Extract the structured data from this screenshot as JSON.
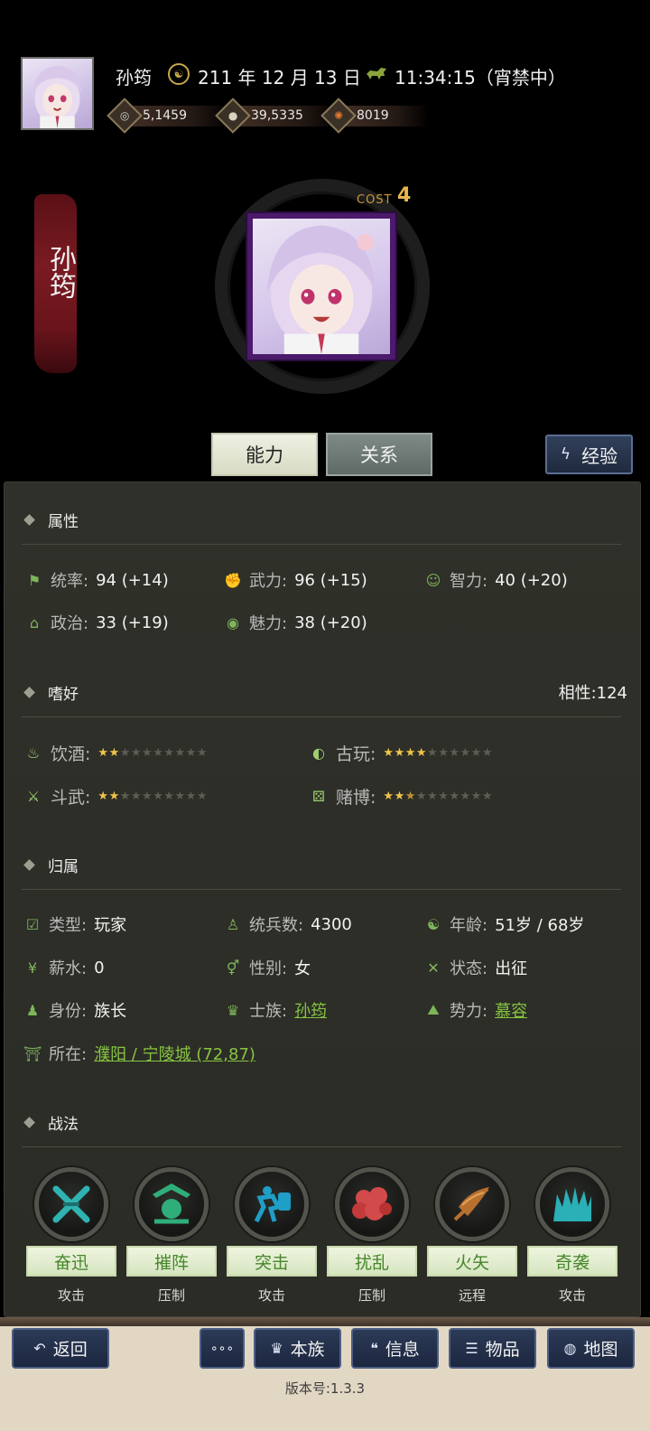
{
  "header": {
    "name": "孙筠",
    "date": "211 年 12 月 13 日",
    "time": "11:34:15（宵禁中）",
    "date_icon": "calendar-clock-icon",
    "time_icon": "horse-icon",
    "resources": [
      {
        "icon": "coin-icon",
        "value": "5,1459"
      },
      {
        "icon": "grain-icon",
        "value": "39,5335"
      },
      {
        "icon": "token-icon",
        "value": "8019"
      }
    ]
  },
  "character": {
    "banner_name": "孙筠",
    "cost_label": "COST",
    "cost_value": "4"
  },
  "tabs": {
    "ability": "能力",
    "relation": "关系",
    "experience": "经验"
  },
  "attributes": {
    "title": "属性",
    "items": [
      {
        "label": "统率:",
        "value": "94 (+14)"
      },
      {
        "label": "武力:",
        "value": "96 (+15)"
      },
      {
        "label": "智力:",
        "value": "40 (+20)"
      },
      {
        "label": "政治:",
        "value": "33 (+19)"
      },
      {
        "label": "魅力:",
        "value": "38 (+20)"
      }
    ]
  },
  "hobbies": {
    "title": "嗜好",
    "affinity": "相性:124",
    "items": [
      {
        "label": "饮酒:",
        "stars": 2,
        "max": 10
      },
      {
        "label": "古玩:",
        "stars": 4,
        "max": 10
      },
      {
        "label": "斗武:",
        "stars": 2,
        "max": 10
      },
      {
        "label": "赌博:",
        "stars": 2.5,
        "max": 10
      }
    ]
  },
  "belonging": {
    "title": "归属",
    "items": [
      {
        "label": "类型:",
        "value": "玩家"
      },
      {
        "label": "统兵数:",
        "value": "4300"
      },
      {
        "label": "年龄:",
        "value": "51岁 / 68岁"
      },
      {
        "label": "薪水:",
        "value": "0"
      },
      {
        "label": "性别:",
        "value": "女"
      },
      {
        "label": "状态:",
        "value": "出征"
      },
      {
        "label": "身份:",
        "value": "族长"
      },
      {
        "label": "士族:",
        "value": "孙筠"
      },
      {
        "label": "势力:",
        "value": "慕容"
      },
      {
        "label": "所在:",
        "value": "濮阳 / 宁陵城 (72,87)"
      }
    ]
  },
  "tactics": {
    "title": "战法",
    "items": [
      {
        "name": "奋迅",
        "type": "攻击",
        "color": "#2fb3b0"
      },
      {
        "name": "摧阵",
        "type": "压制",
        "color": "#2fae7a"
      },
      {
        "name": "突击",
        "type": "攻击",
        "color": "#1f9ec7"
      },
      {
        "name": "扰乱",
        "type": "压制",
        "color": "#d24a4a"
      },
      {
        "name": "火矢",
        "type": "远程",
        "color": "#b8702f"
      },
      {
        "name": "奇袭",
        "type": "攻击",
        "color": "#2ab0b6"
      }
    ]
  },
  "nav": {
    "back": "返回",
    "more": "∘∘∘",
    "clan": "本族",
    "info": "信息",
    "items": "物品",
    "map": "地图",
    "version": "版本号:1.3.3"
  }
}
